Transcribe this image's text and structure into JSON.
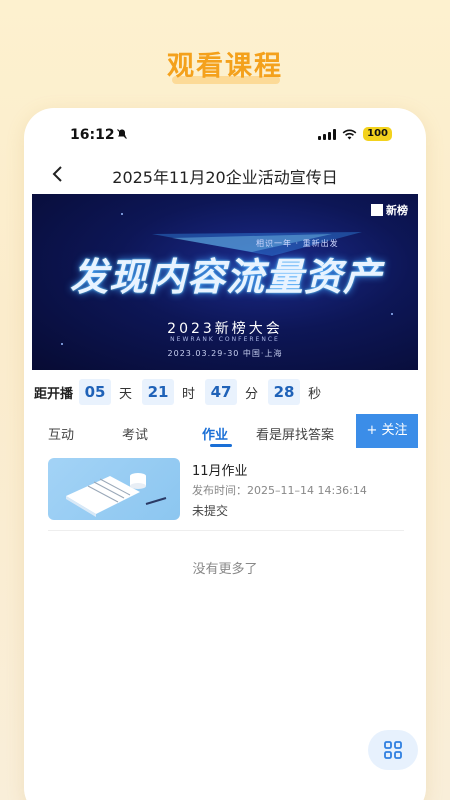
{
  "promo": {
    "title": "观看课程"
  },
  "status": {
    "time": "16:12",
    "battery": "100"
  },
  "nav": {
    "title": "2025年11月20企业活动宣传日"
  },
  "banner": {
    "logo": "新榜",
    "slogan": "相识一年 · 重新出发",
    "headline": "发现内容流量资产",
    "conference": "2023新榜大会",
    "conference_en": "NEWRANK CONFERENCE",
    "date": "2023.03.29-30    中国·上海"
  },
  "countdown": {
    "label": "距开播",
    "days": "05",
    "days_unit": "天",
    "hours": "21",
    "hours_unit": "时",
    "minutes": "47",
    "minutes_unit": "分",
    "seconds": "28",
    "seconds_unit": "秒"
  },
  "tabs": [
    {
      "label": "互动"
    },
    {
      "label": "考试"
    },
    {
      "label": "作业",
      "active": true
    },
    {
      "label": "看是屏找答案"
    }
  ],
  "follow_label": "+ 关注",
  "homework": {
    "title": "11月作业",
    "publish_time": "发布时间：2025–11–14 14:36:14",
    "status": "未提交"
  },
  "no_more": "没有更多了",
  "colors": {
    "accent": "#1a6fd6",
    "promo": "#f4a11c",
    "follow": "#3b8de8"
  }
}
